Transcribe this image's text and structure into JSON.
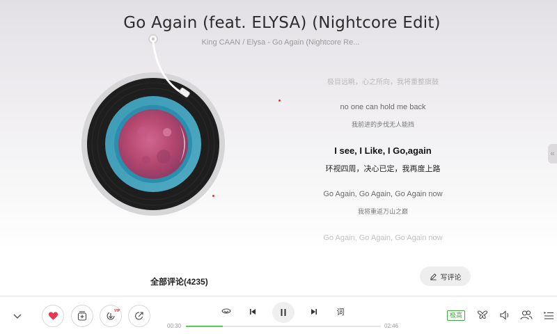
{
  "song": {
    "title": "Go Again (feat. ELYSA) (Nightcore Edit)",
    "subtitle": "King CAAN / Elysa - Go Again (Nightcore Re..."
  },
  "lyrics": [
    {
      "text": "极目远眺，心之所向，我将重整旗鼓",
      "style": "faded"
    },
    {
      "text": "no one can hold me back",
      "style": "en"
    },
    {
      "text": "我前进的步伐无人能挡",
      "style": "cn"
    },
    {
      "text": "I see, I Like, I Go,again",
      "style": "current-en"
    },
    {
      "text": "环视四周，决心已定，我再度上路",
      "style": "current-cn"
    },
    {
      "text": "Go Again, Go Again, Go Again now",
      "style": "en"
    },
    {
      "text": "我将重返万山之巅",
      "style": "cn"
    },
    {
      "text": "Go Again, Go Again, Go Again now",
      "style": "faint"
    }
  ],
  "comments": {
    "header": "全部评论(4235)",
    "write_label": "写评论"
  },
  "player": {
    "current_time": "00:30",
    "total_time": "02:46",
    "progress": 0.19,
    "quality_label": "极高",
    "lyric_toggle_label": "词",
    "vip_badge": "VIP",
    "accent_color": "#4bd34b",
    "like_color": "#e8384f"
  },
  "icons": {
    "collapse": "chevron-down-icon",
    "like": "heart-icon",
    "add": "add-to-playlist-icon",
    "download": "download-icon",
    "share": "share-icon",
    "mode": "loop-mode-icon",
    "prev": "previous-icon",
    "pause": "pause-icon",
    "next": "next-icon",
    "effects": "butterfly-effects-icon",
    "volume": "volume-icon",
    "listen_together": "listen-together-icon",
    "playlist": "playlist-icon",
    "side": "double-chevron-left-icon"
  },
  "side_tab": {
    "glyph": "«"
  }
}
